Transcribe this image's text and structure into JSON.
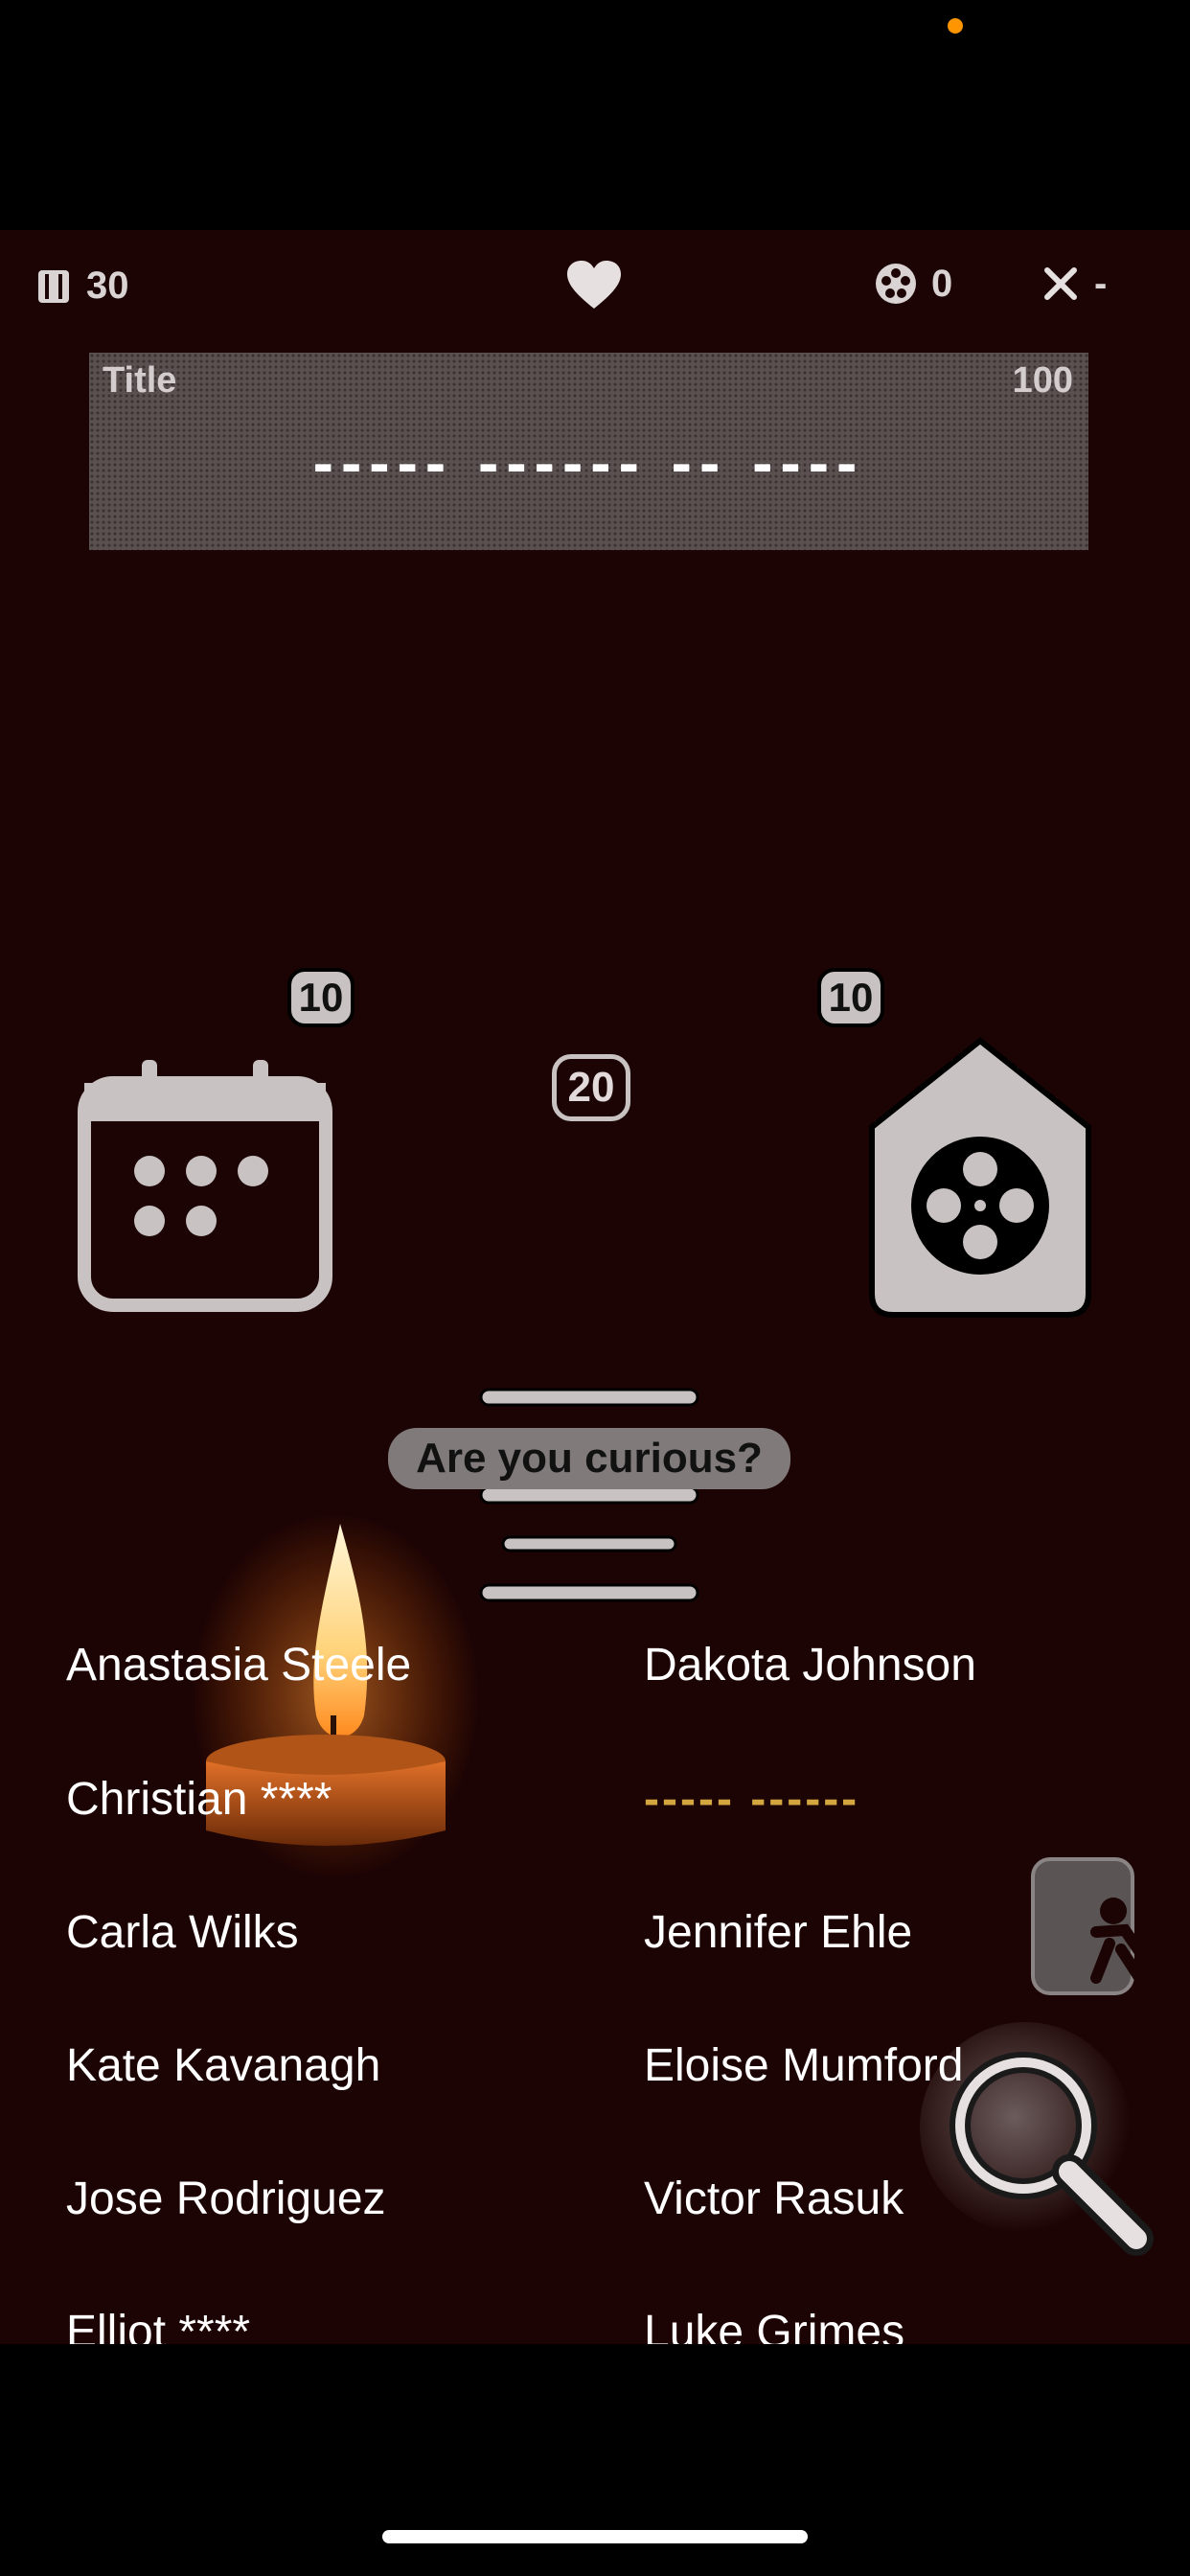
{
  "hud": {
    "cards_count": "30",
    "score": "0",
    "close_value": "-"
  },
  "title_box": {
    "label": "Title",
    "points": "100",
    "masked_answer": "----- ------ -- ----"
  },
  "hints": {
    "calendar_cost": "10",
    "lines_cost": "20",
    "film_cost": "10",
    "prompt": "Are you curious?"
  },
  "cast": {
    "characters": [
      "Anastasia Steele",
      "Christian ****",
      "Carla Wilks",
      "Kate Kavanagh",
      "Jose Rodriguez",
      "Elliot ****"
    ],
    "actors": [
      "Dakota Johnson",
      "----- ------",
      "Jennifer Ehle",
      "Eloise Mumford",
      "Victor Rasuk",
      "Luke Grimes"
    ]
  },
  "colors": {
    "background": "#1d0404",
    "hidden_text": "#d4a640",
    "status_dot": "#ff9500"
  }
}
